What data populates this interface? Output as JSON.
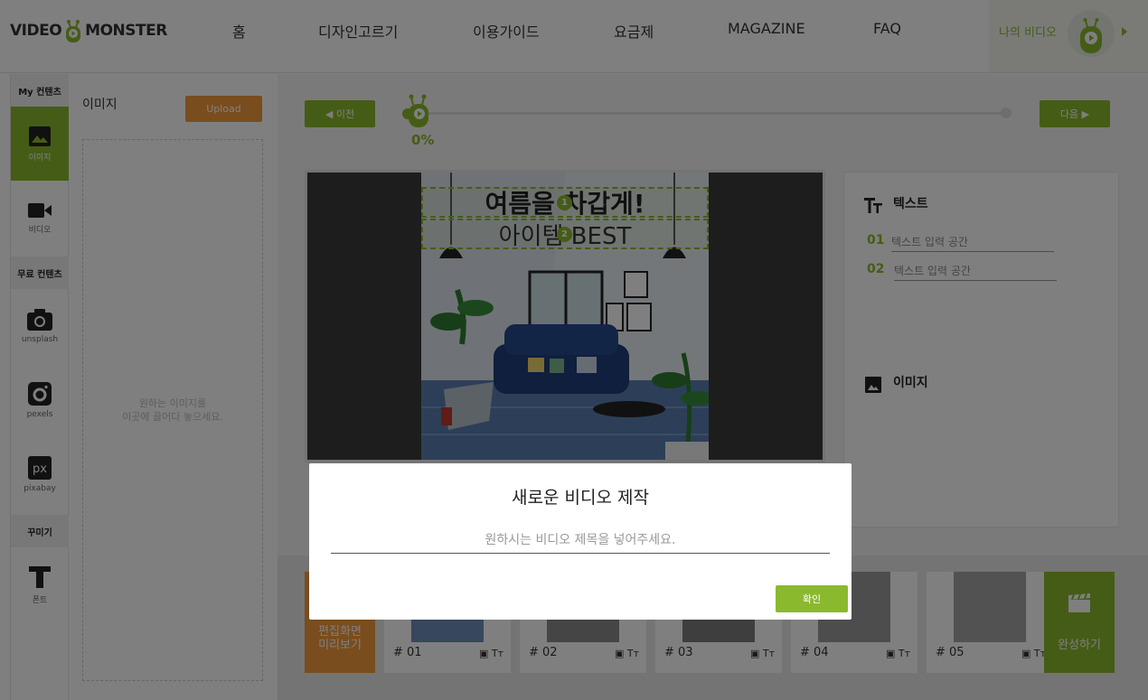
{
  "header": {
    "logo_text_left": "VIDEO",
    "logo_text_right": "MONSTER",
    "nav": [
      {
        "label": "홈"
      },
      {
        "label": "디자인고르기"
      },
      {
        "label": "이용가이드"
      },
      {
        "label": "요금제"
      },
      {
        "label": "MAGAZINE"
      },
      {
        "label": "FAQ"
      }
    ],
    "user_link": "나의 비디오"
  },
  "sidebar": {
    "section_my": "My 컨텐츠",
    "section_free": "무료 컨텐츠",
    "section_deco": "꾸미기",
    "items": [
      {
        "label": "이미지",
        "icon": "image-icon",
        "active": true
      },
      {
        "label": "비디오",
        "icon": "video-camera-icon"
      },
      {
        "label": "unsplash",
        "icon": "camera-icon"
      },
      {
        "label": "pexels",
        "icon": "pexels-icon"
      },
      {
        "label": "pixabay",
        "icon": "pixabay-icon"
      },
      {
        "label": "폰트",
        "icon": "font-icon"
      }
    ]
  },
  "image_panel": {
    "title": "이미지",
    "upload_label": "Upload",
    "drop_hint_line1": "원하는 이미지를",
    "drop_hint_line2": "이곳에 끌어다 놓으세요."
  },
  "editor": {
    "prev_label": "◀ 이전",
    "next_label": "다음 ▶",
    "progress_text": "0%",
    "progress": 0,
    "scene_text_1": "여름을 차갑게!",
    "scene_text_2": "아이템 BEST",
    "badge_1": "1",
    "badge_2": "2",
    "right_panel": {
      "text_heading": "텍스트",
      "image_heading": "이미지",
      "fields": [
        {
          "num": "01",
          "placeholder": "텍스트 입력 공간"
        },
        {
          "num": "02",
          "placeholder": "텍스트 입력 공간"
        }
      ]
    }
  },
  "strip": {
    "preview_label_1": "편집화면",
    "preview_label_2": "미리보기",
    "scenes": [
      {
        "num": "# 01"
      },
      {
        "num": "# 02"
      },
      {
        "num": "# 03"
      },
      {
        "num": "# 04"
      },
      {
        "num": "# 05"
      }
    ],
    "done_label": "완성하기"
  },
  "modal": {
    "title": "새로운 비디오 제작",
    "placeholder": "원하시는 비디오 제목을 넣어주세요.",
    "confirm_label": "확인"
  },
  "colors": {
    "accent": "#8ab92d",
    "orange": "#f39a3b"
  }
}
